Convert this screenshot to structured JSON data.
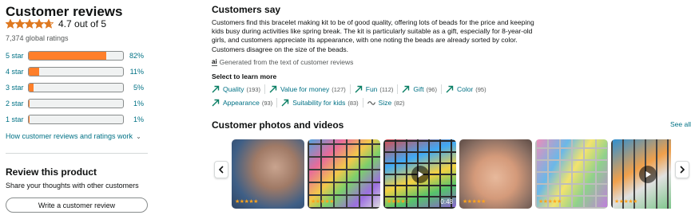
{
  "reviews": {
    "title": "Customer reviews",
    "rating_value": 4.7,
    "rating_text": "4.7 out of 5",
    "global_ratings": "7,374 global ratings",
    "star_color": "#DE7921",
    "histogram": [
      {
        "label": "5 star",
        "percent": 82,
        "percent_text": "82%"
      },
      {
        "label": "4 star",
        "percent": 11,
        "percent_text": "11%"
      },
      {
        "label": "3 star",
        "percent": 5,
        "percent_text": "5%"
      },
      {
        "label": "2 star",
        "percent": 1,
        "percent_text": "1%"
      },
      {
        "label": "1 star",
        "percent": 1,
        "percent_text": "1%"
      }
    ],
    "how_link": "How customer reviews and ratings work",
    "review_title": "Review this product",
    "share_text": "Share your thoughts with other customers",
    "write_button": "Write a customer review"
  },
  "say": {
    "title": "Customers say",
    "summary": "Customers find this bracelet making kit to be of good quality, offering lots of beads for the price and keeping kids busy during activities like spring break. The kit is particularly suitable as a gift, especially for 8-year-old girls, and customers appreciate its appearance, with one noting the beads are already sorted by color. Customers disagree on the size of the beads.",
    "generated": "Generated from the text of customer reviews",
    "ai_icon_text": "ai",
    "select_label": "Select to learn more",
    "aspects": [
      {
        "label": "Quality",
        "count": "(193)",
        "icon": "trend-up-icon"
      },
      {
        "label": "Value for money",
        "count": "(127)",
        "icon": "trend-up-icon"
      },
      {
        "label": "Fun",
        "count": "(112)",
        "icon": "trend-up-icon"
      },
      {
        "label": "Gift",
        "count": "(96)",
        "icon": "trend-up-icon"
      },
      {
        "label": "Color",
        "count": "(95)",
        "icon": "trend-up-icon"
      },
      {
        "label": "Appearance",
        "count": "(93)",
        "icon": "trend-up-icon"
      },
      {
        "label": "Suitability for kids",
        "count": "(83)",
        "icon": "trend-up-icon"
      },
      {
        "label": "Size",
        "count": "(82)",
        "icon": "mixed-wave-icon"
      }
    ]
  },
  "photos": {
    "title": "Customer photos and videos",
    "see_all": "See all",
    "items": [
      {
        "rating": 5,
        "video": false,
        "duration": "",
        "theme": "wrist"
      },
      {
        "rating": 5,
        "video": false,
        "duration": "",
        "theme": "bead-box"
      },
      {
        "rating": 4,
        "video": true,
        "duration": "0:48",
        "theme": "video-box"
      },
      {
        "rating": 5,
        "video": false,
        "duration": "",
        "theme": "hand-bracelet"
      },
      {
        "rating": 5,
        "video": false,
        "duration": "",
        "theme": "bead-box-2"
      },
      {
        "rating": 5,
        "video": true,
        "duration": "",
        "theme": "video-partial"
      }
    ]
  }
}
